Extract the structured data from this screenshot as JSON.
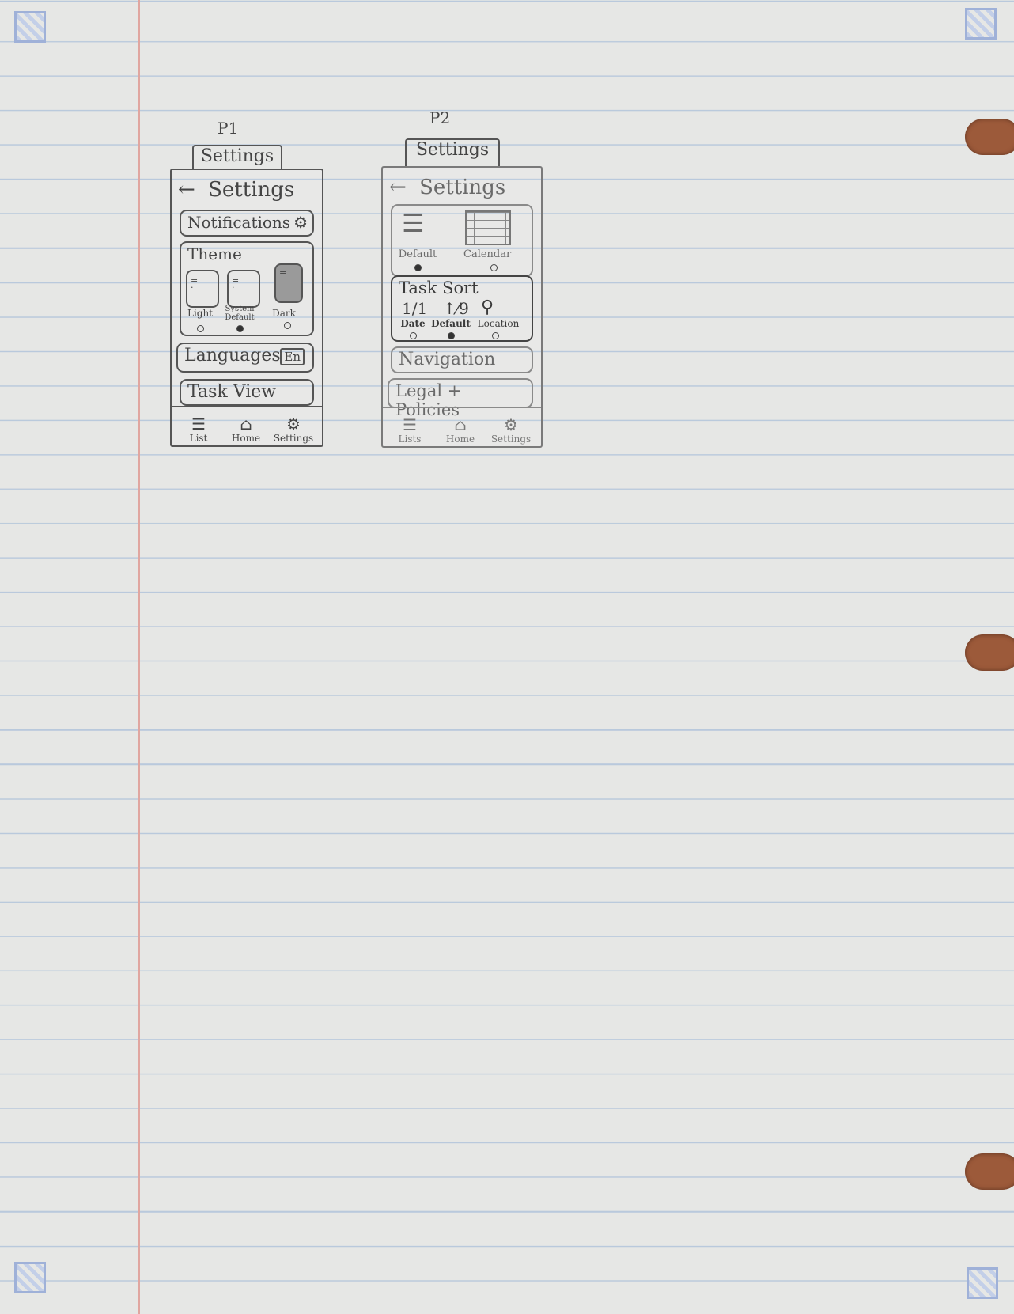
{
  "sketches": [
    {
      "id": "p1",
      "label": "P1",
      "tab_title": "Settings",
      "header": {
        "back_icon": "←",
        "title": "Settings"
      },
      "rows": {
        "notifications": {
          "label": "Notifications",
          "icon": "gear-icon"
        },
        "theme": {
          "label": "Theme",
          "options": [
            {
              "label": "Light",
              "selected": false
            },
            {
              "label": "System Default",
              "selected": true
            },
            {
              "label": "Dark",
              "selected": false
            }
          ]
        },
        "languages": {
          "label": "Languages",
          "badge": "En"
        },
        "task_view": {
          "label": "Task View"
        }
      },
      "nav": [
        {
          "label": "List",
          "icon": "menu-icon"
        },
        {
          "label": "Home",
          "icon": "home-icon"
        },
        {
          "label": "Settings",
          "icon": "gear-icon"
        }
      ]
    },
    {
      "id": "p2",
      "label": "P2",
      "tab_title": "Settings",
      "header": {
        "back_icon": "←",
        "title": "Settings"
      },
      "rows": {
        "default_view": {
          "options": [
            {
              "label": "Default",
              "selected": true
            },
            {
              "label": "Calendar",
              "selected": false
            }
          ]
        },
        "task_sort": {
          "label": "Task Sort",
          "options": [
            {
              "label": "Date",
              "glyph": "1/1",
              "selected": false
            },
            {
              "label": "Default",
              "glyph": "↑⁄9",
              "selected": true
            },
            {
              "label": "Location",
              "glyph": "⚲",
              "selected": false
            }
          ]
        },
        "navigation": {
          "label": "Navigation"
        },
        "legal": {
          "label": "Legal + Policies"
        }
      },
      "nav": [
        {
          "label": "Lists",
          "icon": "menu-icon"
        },
        {
          "label": "Home",
          "icon": "home-icon"
        },
        {
          "label": "Settings",
          "icon": "gear-icon"
        }
      ]
    }
  ]
}
